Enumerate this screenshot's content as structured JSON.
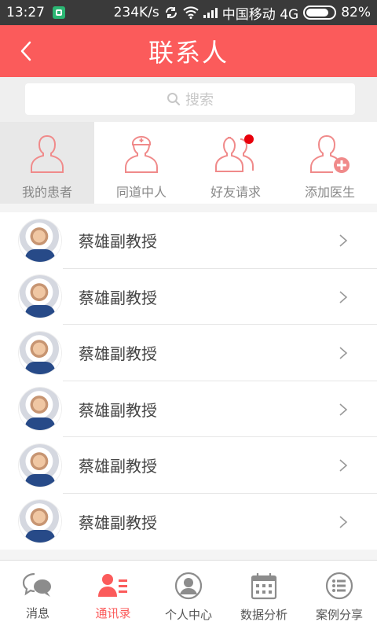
{
  "status_bar": {
    "time": "13:27",
    "speed": "234K/s",
    "carrier": "中国移动 4G",
    "battery": "82%",
    "battery_level": 0.82
  },
  "header": {
    "title": "联系人"
  },
  "search": {
    "placeholder": "搜索"
  },
  "categories": [
    {
      "label": "我的患者",
      "icon": "person-icon",
      "active": true
    },
    {
      "label": "同道中人",
      "icon": "doctor-icon",
      "active": false
    },
    {
      "label": "好友请求",
      "icon": "friends-request-icon",
      "active": false
    },
    {
      "label": "添加医生",
      "icon": "add-doctor-icon",
      "active": false
    }
  ],
  "contacts": [
    {
      "name": "蔡雄副教授"
    },
    {
      "name": "蔡雄副教授"
    },
    {
      "name": "蔡雄副教授"
    },
    {
      "name": "蔡雄副教授"
    },
    {
      "name": "蔡雄副教授"
    },
    {
      "name": "蔡雄副教授"
    }
  ],
  "bottom_nav": [
    {
      "label": "消息",
      "icon": "chat-icon",
      "active": false
    },
    {
      "label": "通讯录",
      "icon": "contacts-icon",
      "active": true
    },
    {
      "label": "个人中心",
      "icon": "profile-icon",
      "active": false
    },
    {
      "label": "数据分析",
      "icon": "calendar-icon",
      "active": false
    },
    {
      "label": "案例分享",
      "icon": "list-icon",
      "active": false
    }
  ],
  "colors": {
    "accent": "#fb5b5b",
    "icon_outline": "#f08a8a",
    "status_bar": "#3a3a3a"
  }
}
